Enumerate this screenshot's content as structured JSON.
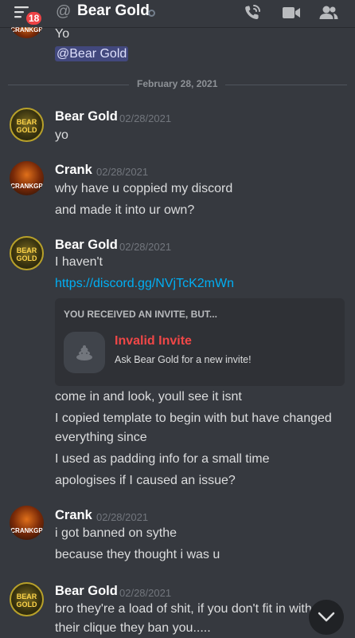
{
  "header": {
    "badge_count": "18",
    "channel_icon": "@",
    "title": "Bear Gold"
  },
  "date_divider": "February 28, 2021",
  "messages": [
    {
      "author": "",
      "avatar_text": "CRANKGP",
      "lines": [
        "Yo",
        "@Bear Gold"
      ]
    },
    {
      "author": "Bear Gold",
      "timestamp": "02/28/2021",
      "avatar_text": "BEAR GOLD",
      "lines": [
        "yo"
      ]
    },
    {
      "author": "Crank",
      "timestamp": "02/28/2021",
      "avatar_text": "CRANKGP",
      "lines": [
        "why have u coppied my discord",
        "and made it into ur own?"
      ]
    },
    {
      "author": "Bear Gold",
      "timestamp": "02/28/2021",
      "avatar_text": "BEAR GOLD",
      "lines": [
        "I haven't",
        "https://discord.gg/NVjTcK2mWn",
        "come in and look, youll see it isnt",
        "I copied template to begin with but have changed",
        "everything since",
        "I used as padding info for a small time",
        "apologises if I caused an issue?"
      ]
    },
    {
      "author": "Crank",
      "timestamp": "02/28/2021",
      "avatar_text": "CRANKGP",
      "lines": [
        "i got banned on sythe",
        "because they thought i was u"
      ]
    },
    {
      "author": "Bear Gold",
      "timestamp": "02/28/2021",
      "avatar_text": "BEAR GOLD",
      "lines": [
        "bro they're a load of shit, if you don't fit in with",
        "their clique they ban you....."
      ]
    }
  ],
  "invite": {
    "header": "YOU RECEIVED AN INVITE, BUT...",
    "title": "Invalid Invite",
    "subtitle": "Ask Bear Gold for a new invite!"
  },
  "colors": {
    "background": "#36393f",
    "badge": "#ed4245",
    "link": "#00aff4",
    "invalid": "#f04747"
  }
}
